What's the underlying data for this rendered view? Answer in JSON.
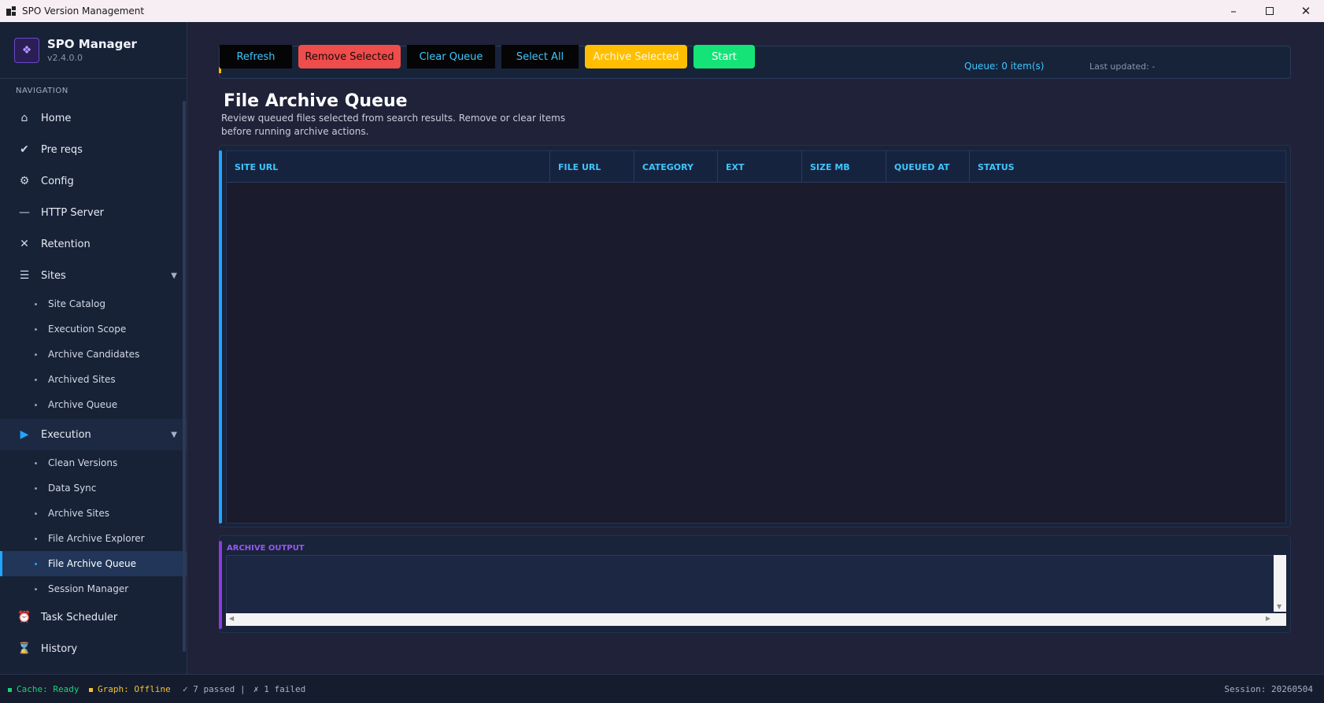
{
  "window": {
    "title": "SPO Version Management"
  },
  "brand": {
    "name": "SPO Manager",
    "version": "v2.4.0.0"
  },
  "nav": {
    "heading": "NAVIGATION",
    "items": [
      {
        "label": "Home",
        "icon": "home-icon"
      },
      {
        "label": "Pre reqs",
        "icon": "check-icon"
      },
      {
        "label": "Config",
        "icon": "gear-icon"
      },
      {
        "label": "HTTP Server",
        "icon": "minus-icon"
      },
      {
        "label": "Retention",
        "icon": "close-icon"
      },
      {
        "label": "Sites",
        "icon": "list-icon",
        "expanded": true,
        "children": [
          "Site Catalog",
          "Execution Scope",
          "Archive Candidates",
          "Archived Sites",
          "Archive Queue"
        ]
      },
      {
        "label": "Execution",
        "icon": "play-icon",
        "expanded": true,
        "active": true,
        "children": [
          "Clean Versions",
          "Data Sync",
          "Archive Sites",
          "File Archive Explorer",
          "File Archive Queue",
          "Session Manager"
        ]
      },
      {
        "label": "Task Scheduler",
        "icon": "alarm-clock-icon"
      },
      {
        "label": "History",
        "icon": "hourglass-icon"
      }
    ],
    "active_child": "File Archive Queue"
  },
  "toolbar": {
    "refresh": "Refresh",
    "remove_selected": "Remove Selected",
    "clear_queue": "Clear Queue",
    "select_all": "Select All",
    "archive_selected": "Archive Selected",
    "start": "Start",
    "queue_count": "Queue: 0 item(s)",
    "last_updated": "Last updated: -"
  },
  "page": {
    "title": "File Archive Queue",
    "description": "Review queued files selected from search results. Remove or clear items before running archive actions."
  },
  "table": {
    "columns": [
      "SITE URL",
      "FILE URL",
      "CATEGORY",
      "EXT",
      "SIZE MB",
      "QUEUED AT",
      "STATUS"
    ],
    "rows": []
  },
  "output": {
    "label": "ARCHIVE OUTPUT",
    "text": ""
  },
  "status": {
    "cache": "Cache: Ready",
    "graph": "Graph: Offline",
    "passed": "✓ 7 passed",
    "separator": "|",
    "failed": "✗ 1 failed",
    "session": "Session: 20260504"
  },
  "colors": {
    "accent_blue": "#1ea7ff",
    "danger": "#ef4c4c",
    "warning": "#ffbf00",
    "success": "#14e477",
    "output_accent": "#8b3ce0"
  }
}
